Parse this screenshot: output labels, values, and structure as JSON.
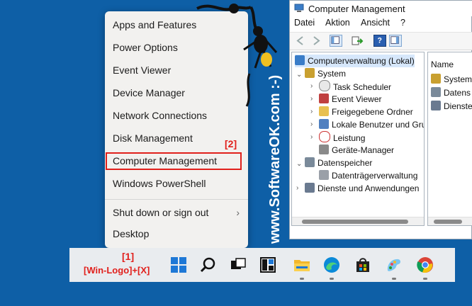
{
  "winx_menu": {
    "items": [
      {
        "label": "Apps and Features"
      },
      {
        "label": "Power Options"
      },
      {
        "label": "Event Viewer"
      },
      {
        "label": "Device Manager"
      },
      {
        "label": "Network Connections"
      },
      {
        "label": "Disk Management"
      },
      {
        "label": "Computer Management"
      },
      {
        "label": "Windows PowerShell"
      },
      {
        "label": "Shut down or sign out"
      },
      {
        "label": "Desktop"
      }
    ],
    "chevron": "›"
  },
  "annotations": {
    "step2": "[2]",
    "step1": "[1]",
    "shortcut": "[Win-Logo]+[X]",
    "highlight_color": "#e1201c"
  },
  "watermark": "www.SoftwareOK.com :-)",
  "cm_window": {
    "title": "Computer Management",
    "menu": [
      "Datei",
      "Aktion",
      "Ansicht",
      "?"
    ],
    "tree": [
      {
        "label": "Computerverwaltung (Lokal)",
        "icon": "computer-icon"
      },
      {
        "label": "System",
        "icon": "tools-icon"
      },
      {
        "label": "Task Scheduler",
        "icon": "clock-icon"
      },
      {
        "label": "Event Viewer",
        "icon": "event-viewer-icon"
      },
      {
        "label": "Freigegebene Ordner",
        "icon": "shared-folder-icon"
      },
      {
        "label": "Lokale Benutzer und Gru",
        "icon": "users-icon"
      },
      {
        "label": "Leistung",
        "icon": "performance-icon"
      },
      {
        "label": "Geräte-Manager",
        "icon": "device-manager-icon"
      },
      {
        "label": "Datenspeicher",
        "icon": "storage-icon"
      },
      {
        "label": "Datenträgerverwaltung",
        "icon": "disk-icon"
      },
      {
        "label": "Dienste und Anwendungen",
        "icon": "services-icon"
      }
    ],
    "list_header": "Name",
    "list_items": [
      "System",
      "Datens",
      "Dienste"
    ]
  },
  "taskbar_icons": [
    "start-icon",
    "search-icon",
    "task-view-icon",
    "widgets-icon",
    "file-explorer-icon",
    "edge-icon",
    "store-icon",
    "paint-icon",
    "chrome-icon"
  ]
}
